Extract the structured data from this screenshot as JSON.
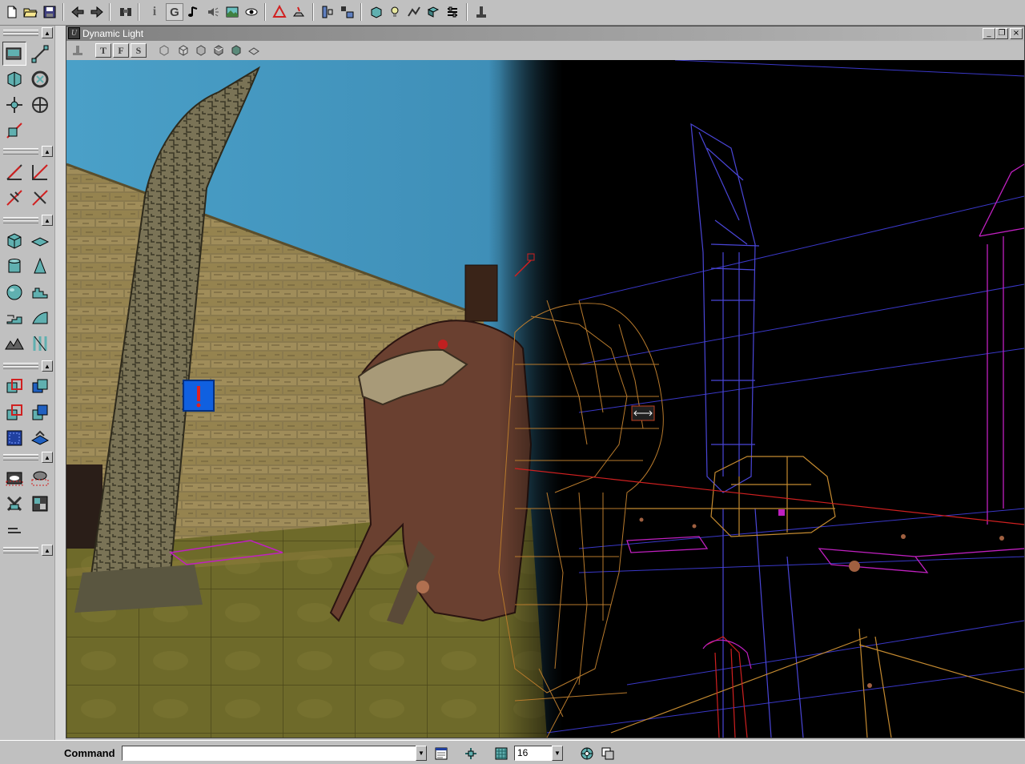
{
  "window": {
    "title": "Dynamic Light",
    "app_glyph": "U",
    "minimize": "_",
    "restore": "❐",
    "close": "×"
  },
  "top_toolbar": {
    "icons": [
      "new-file-icon",
      "open-folder-icon",
      "save-icon",
      "undo-icon",
      "redo-icon",
      "search-actors-icon",
      "actor-properties-icon",
      "texture-browser-icon",
      "music-browser-icon",
      "sound-browser-icon",
      "graphics-browser-icon",
      "mesh-viewer-icon",
      "rebuild-geometry-icon",
      "build-lighting-icon",
      "build-all-icon",
      "2d-shape-editor-icon",
      "cube-preview-icon",
      "lightbulb-icon",
      "path-icon",
      "mesh-icon",
      "build-options-icon",
      "play-level-icon"
    ],
    "grid_label": "G",
    "info_label": "i"
  },
  "viewport_toolbar": {
    "view_buttons": [
      "T",
      "F",
      "S"
    ],
    "icons": [
      "pin-icon",
      "wireframe-cube-icon",
      "zone-cube-icon",
      "texture-usage-icon",
      "lighting-cube-icon",
      "dynamic-light-cube-icon",
      "sheet-icon"
    ]
  },
  "left_palette": {
    "collapse_glyph": "▲",
    "groups": [
      [
        "camera-move-icon",
        "vertex-editing-icon"
      ],
      [
        "brush-rotate-icon",
        "brush-sheer-icon"
      ],
      [
        "brush-scale-icon",
        "brush-stretch-icon"
      ],
      [
        "brush-clip-icon"
      ],
      [
        "clip-segment-icon",
        "clip-split-icon"
      ],
      [
        "clip-flip-icon",
        "clip-delete-icon"
      ],
      [
        "cube-builder-icon",
        "sheet-builder-icon"
      ],
      [
        "cylinder-builder-icon",
        "cone-builder-icon"
      ],
      [
        "sphere-builder-icon",
        "stair-builder-icon"
      ],
      [
        "spiral-stair-icon",
        "curved-stair-icon"
      ],
      [
        "terrain-builder-icon",
        "volumetric-icon"
      ],
      [
        "add-brush-icon",
        "subtract-brush-icon"
      ],
      [
        "intersect-brush-icon",
        "deintersect-brush-icon"
      ],
      [
        "add-mover-icon",
        "add-special-icon"
      ],
      [
        "show-selected-icon",
        "hide-selected-icon"
      ],
      [
        "select-none-icon",
        "invert-selection-icon"
      ],
      [
        "camera-align-icon"
      ]
    ]
  },
  "status_bar": {
    "command_label": "Command",
    "command_value": "",
    "grid_size": "16",
    "combo_arrow": "▼"
  },
  "colors": {
    "sky": "#4aa0c8",
    "wireframe_blue": "#4a46d8",
    "wireframe_orange": "#b87a2c",
    "wireframe_magenta": "#c020c0",
    "titlebar": "#808080"
  }
}
